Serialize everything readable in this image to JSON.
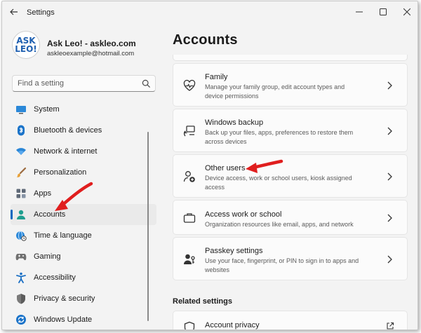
{
  "window": {
    "title": "Settings"
  },
  "profile": {
    "name": "Ask Leo! - askleo.com",
    "email": "askleoexample@hotmail.com",
    "avatar_line1": "ASK",
    "avatar_line2": "LEO!"
  },
  "search": {
    "placeholder": "Find a setting"
  },
  "nav": {
    "items": [
      {
        "label": "System",
        "icon": "system-icon"
      },
      {
        "label": "Bluetooth & devices",
        "icon": "bluetooth-icon"
      },
      {
        "label": "Network & internet",
        "icon": "wifi-icon"
      },
      {
        "label": "Personalization",
        "icon": "brush-icon"
      },
      {
        "label": "Apps",
        "icon": "apps-icon"
      },
      {
        "label": "Accounts",
        "icon": "person-icon",
        "selected": true
      },
      {
        "label": "Time & language",
        "icon": "globe-clock-icon"
      },
      {
        "label": "Gaming",
        "icon": "gamepad-icon"
      },
      {
        "label": "Accessibility",
        "icon": "accessibility-icon"
      },
      {
        "label": "Privacy & security",
        "icon": "shield-icon"
      },
      {
        "label": "Windows Update",
        "icon": "update-icon"
      }
    ]
  },
  "main": {
    "title": "Accounts",
    "cards": [
      {
        "title": "Family",
        "desc": "Manage your family group, edit account types and device permissions",
        "icon": "family-heart-icon"
      },
      {
        "title": "Windows backup",
        "desc": "Back up your files, apps, preferences to restore them across devices",
        "icon": "backup-icon"
      },
      {
        "title": "Other users",
        "desc": "Device access, work or school users, kiosk assigned access",
        "icon": "add-user-icon"
      },
      {
        "title": "Access work or school",
        "desc": "Organization resources like email, apps, and network",
        "icon": "briefcase-icon"
      },
      {
        "title": "Passkey settings",
        "desc": "Use your face, fingerprint, or PIN to sign in to apps and websites",
        "icon": "passkey-icon"
      }
    ],
    "related_heading": "Related settings",
    "related_items": [
      {
        "title": "Account privacy",
        "icon": "shield-icon"
      }
    ]
  },
  "colors": {
    "accent": "#0067c0",
    "annotation_arrow": "#e01e1e",
    "background": "#f3f3f3"
  }
}
